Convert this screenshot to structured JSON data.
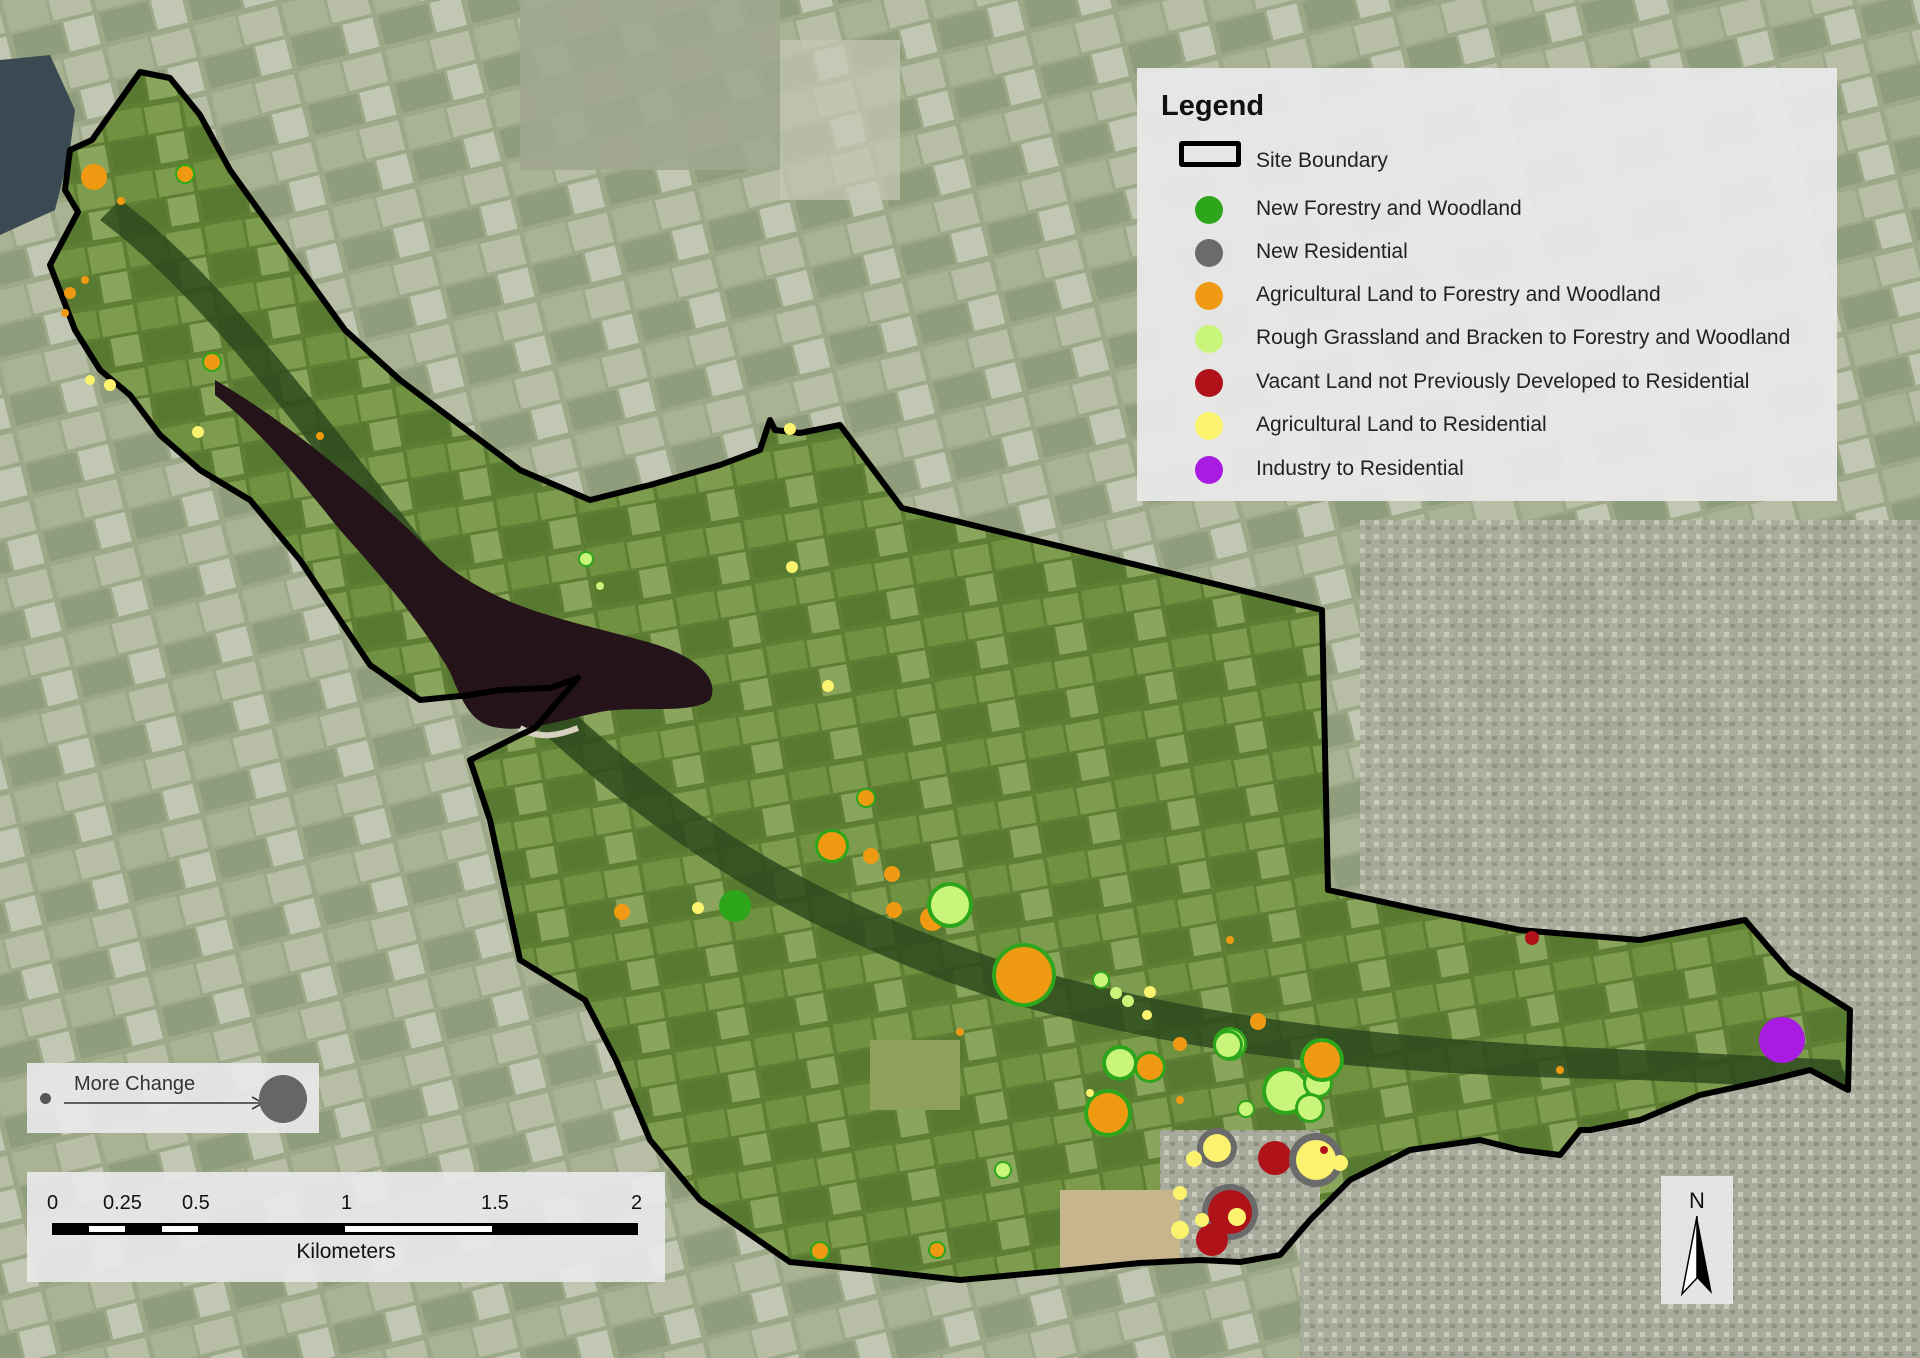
{
  "legend": {
    "title": "Legend",
    "items": [
      {
        "label": "Site Boundary",
        "type": "boundary"
      },
      {
        "label": "New Forestry and Woodland",
        "type": "dot",
        "color": "#2ea61c"
      },
      {
        "label": "New Residential",
        "type": "dot",
        "color": "#6b6b6b"
      },
      {
        "label": "Agricultural Land to Forestry and Woodland",
        "type": "dot",
        "color": "#ef9a12"
      },
      {
        "label": "Rough Grassland and Bracken to Forestry and Woodland",
        "type": "dot",
        "color": "#c8f57a"
      },
      {
        "label": "Vacant Land not Previously Developed to Residential",
        "type": "dot",
        "color": "#b0121a"
      },
      {
        "label": "Agricultural Land to Residential",
        "type": "dot",
        "color": "#fbf36e"
      },
      {
        "label": "Industry to Residential",
        "type": "dot",
        "color": "#a81be0"
      }
    ]
  },
  "size_key": {
    "label": "More Change"
  },
  "scale_bar": {
    "ticks": [
      "0",
      "0.25",
      "0.5",
      "1",
      "1.5",
      "2"
    ],
    "unit": "Kilometers"
  },
  "north_arrow": {
    "label": "N"
  },
  "colors": {
    "new_forestry": "#2ea61c",
    "new_residential": "#6b6b6b",
    "agri_to_forestry": "#ef9a12",
    "grass_to_forestry": "#c8f57a",
    "vacant_to_residential": "#b0121a",
    "agri_to_residential": "#fbf36e",
    "industry_to_residential": "#a81be0"
  }
}
